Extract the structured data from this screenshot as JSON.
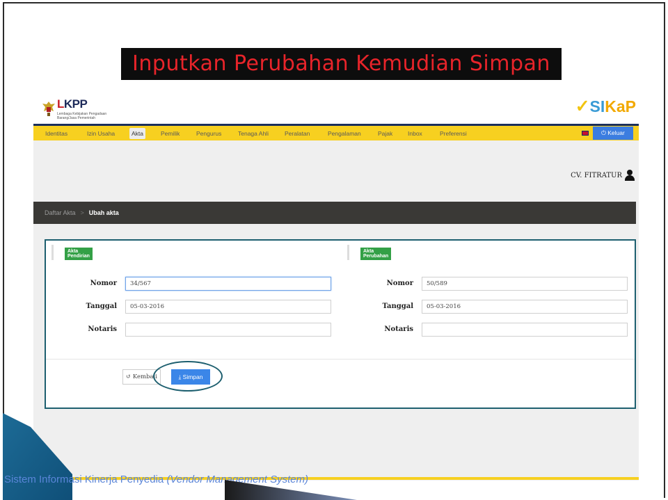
{
  "slide_title": "Inputkan Perubahan Kemudian Simpan",
  "header": {
    "logo_text_a": "L",
    "logo_text_b": "KPP",
    "logo_sub": "Lembaga Kebijakan Pengadaan Barang/Jasa Pemerintah",
    "brand_si": "SI",
    "brand_kap": "KaP"
  },
  "nav": {
    "items": [
      "Identitas",
      "Izin Usaha",
      "Akta",
      "Pemilik",
      "Pengurus",
      "Tenaga Ahli",
      "Peralatan",
      "Pengalaman",
      "Pajak",
      "Inbox",
      "Preferensi"
    ],
    "active": "Akta",
    "logout_label": "Keluar"
  },
  "user": {
    "name": "CV. FITRATUR"
  },
  "breadcrumb": {
    "parent": "Daftar Akta",
    "current": "Ubah akta"
  },
  "form": {
    "left_section": "Akta Pendirian",
    "right_section": "Akta Perubahan",
    "labels": {
      "nomor": "Nomor",
      "tanggal": "Tanggal",
      "notaris": "Notaris"
    },
    "left": {
      "nomor": "34/567",
      "tanggal": "05-03-2016",
      "notaris": ""
    },
    "right": {
      "nomor": "50/589",
      "tanggal": "05-03-2016",
      "notaris": ""
    },
    "back_label": "Kembali",
    "save_label": "Simpan"
  },
  "footer": {
    "text_main": "Sistem Informasi Kinerja Penyedia ",
    "text_em": "(Vendor Management System)"
  },
  "colors": {
    "accent_yellow": "#f7d020",
    "navy": "#1a2f5c",
    "title_red": "#e8242a",
    "save_blue": "#3b86e8",
    "label_green": "#33a046"
  }
}
